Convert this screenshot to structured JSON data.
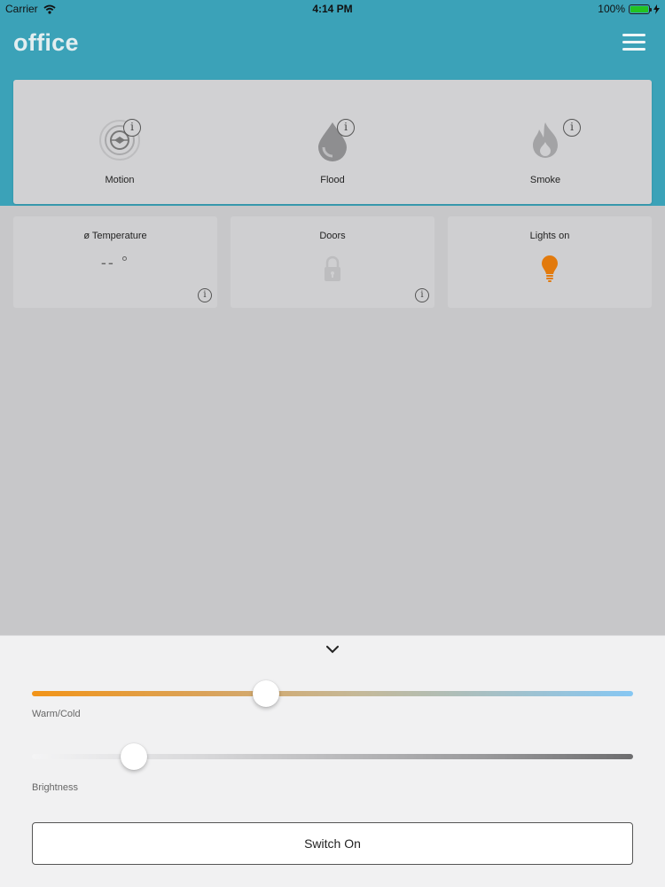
{
  "status_bar": {
    "carrier": "Carrier",
    "time": "4:14 PM",
    "battery": "100%"
  },
  "header": {
    "title": "office"
  },
  "sensors": [
    {
      "label": "Motion",
      "icon": "motion-sensor-icon"
    },
    {
      "label": "Flood",
      "icon": "water-drop-icon"
    },
    {
      "label": "Smoke",
      "icon": "flame-icon"
    }
  ],
  "info_glyph": "i",
  "cards": {
    "temperature": {
      "title": "ø Temperature",
      "value": "-- °"
    },
    "doors": {
      "title": "Doors"
    },
    "lights": {
      "title": "Lights on"
    }
  },
  "controls": {
    "warm_cold": {
      "label": "Warm/Cold",
      "value": 0.39
    },
    "brightness": {
      "label": "Brightness",
      "value": 0.17
    },
    "switch_label": "Switch On"
  },
  "colors": {
    "header": "#3ba2b8",
    "bulb": "#e27a0d",
    "warm": "#f29418",
    "cold": "#86c7f3"
  }
}
